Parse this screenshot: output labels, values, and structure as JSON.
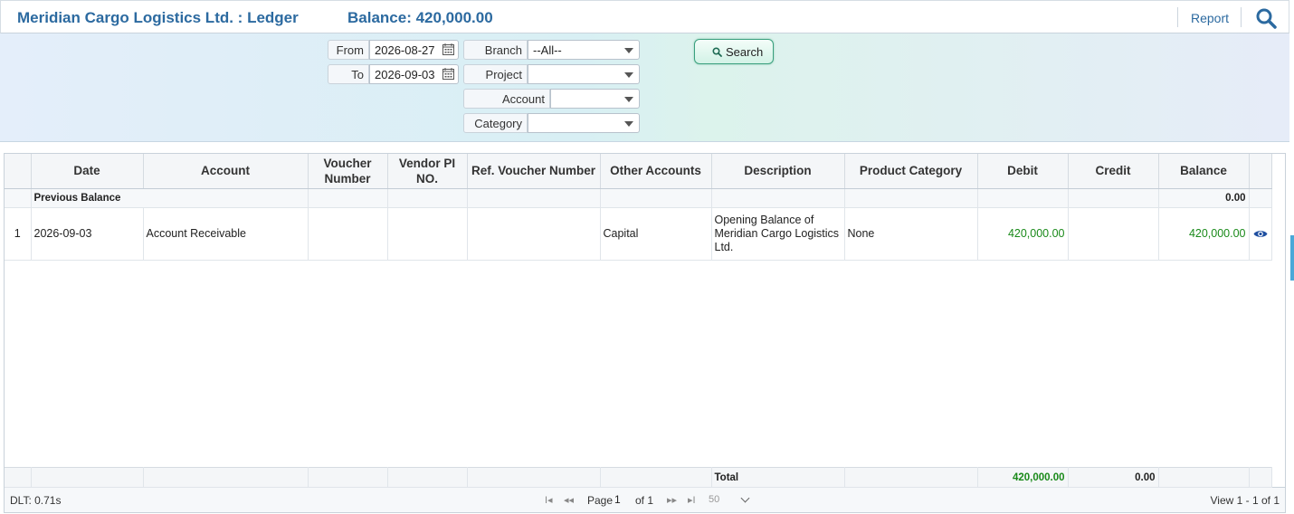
{
  "header": {
    "title": "Meridian Cargo Logistics Ltd. : Ledger",
    "balance": "Balance: 420,000.00",
    "report_label": "Report"
  },
  "filters": {
    "from_label": "From",
    "from_value": "2026-08-27",
    "to_label": "To",
    "to_value": "2026-09-03",
    "branch_label": "Branch",
    "branch_value": "--All--",
    "project_label": "Project",
    "project_value": "",
    "account_label": "Account",
    "account_value": "",
    "category_label": "Category",
    "category_value": "",
    "search_label": "Search"
  },
  "grid": {
    "columns": [
      "Date",
      "Account",
      "Voucher Number",
      "Vendor PI NO.",
      "Ref. Voucher Number",
      "Other Accounts",
      "Description",
      "Product Category",
      "Debit",
      "Credit",
      "Balance"
    ],
    "previous_balance": {
      "label": "Previous Balance",
      "balance": "0.00"
    },
    "rows": [
      {
        "num": "1",
        "date": "2026-09-03",
        "account": "Account Receivable",
        "voucher": "",
        "vendor_pi": "",
        "ref_voucher": "",
        "other_accounts": "Capital",
        "description": "Opening Balance of Meridian Cargo Logistics Ltd.",
        "product_category": "None",
        "debit": "420,000.00",
        "credit": "",
        "balance": "420,000.00"
      }
    ],
    "footer": {
      "label": "Total",
      "debit": "420,000.00",
      "credit": "0.00"
    }
  },
  "pager": {
    "dlt": "DLT: 0.71s",
    "page_label": "Page",
    "page_value": "1",
    "of_label": "of 1",
    "page_size": "50",
    "view": "View 1 - 1 of 1"
  },
  "colors": {
    "accent": "#2c6aa0",
    "positive": "#1a8a1a"
  },
  "icons": [
    "search-icon",
    "calendar-icon",
    "dropdown-caret-icon",
    "eye-icon",
    "first-page-icon",
    "prev-page-icon",
    "next-page-icon",
    "last-page-icon"
  ]
}
